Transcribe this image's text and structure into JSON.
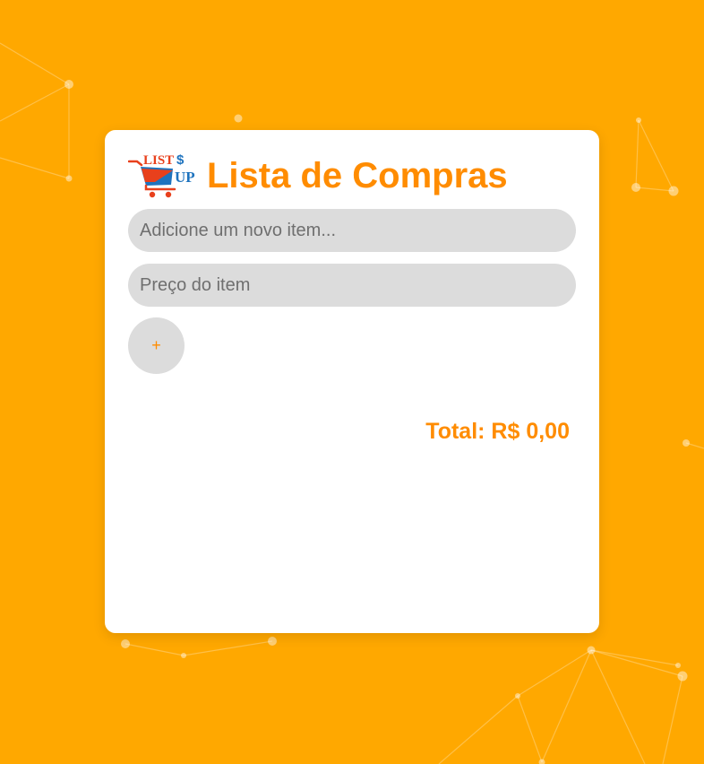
{
  "app": {
    "title": "Lista de Compras",
    "logo": {
      "icon": "cart-logo-icon",
      "text_top": "LIST",
      "text_symbol": "$",
      "text_bottom": "UP"
    }
  },
  "form": {
    "item_placeholder": "Adicione um novo item...",
    "item_value": "",
    "price_placeholder": "Preço do item",
    "price_value": "",
    "add_label": "+"
  },
  "total": {
    "label": "Total: R$ 0,00"
  },
  "items": [],
  "colors": {
    "background": "#FFA800",
    "accent": "#FF8C00",
    "card": "#FFFFFF",
    "field": "#DCDCDC",
    "logo_red": "#E8401C",
    "logo_blue": "#1E73BE"
  }
}
